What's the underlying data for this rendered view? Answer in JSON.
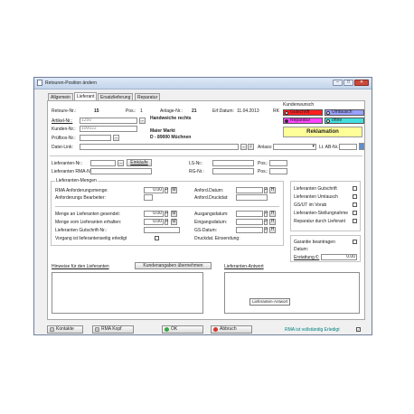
{
  "window": {
    "title": "Retouren-Position ändern",
    "icon": "document-icon"
  },
  "tabs": [
    {
      "label": "Allgemein",
      "active": false
    },
    {
      "label": "Lieferant",
      "active": true
    },
    {
      "label": "Ersatzlieferung",
      "active": false
    },
    {
      "label": "Reparatur",
      "active": false
    }
  ],
  "header": {
    "retoure_label": "Retoure-Nr.:",
    "retoure_value": "15",
    "pos_label": "Pos.:",
    "pos_value": "1",
    "anlage_label": "Anlage-Nr.:",
    "anlage_value": "21",
    "erf_label": "Erf.Datum:",
    "erf_value": "11.04.2013",
    "erf_user": "RK",
    "artikel_label": "Artikel-Nr.:",
    "artikel_value": "1250",
    "artikel_btn": "...",
    "artikel_name": "Handweiche rechts",
    "kunde_label": "Kunden-Nr.:",
    "kunde_value": "100022",
    "kunde_name": "Maier Markt",
    "kunde_city": "D - 89000 Müchnen",
    "pruef_label": "Prüfbox-Nr.:",
    "pruef_btn": "...",
    "datei_label": "Datei-Link:",
    "datei_btn": "...",
    "anlass_label": "Anlass:",
    "ltab_label": "Lt. AB-Nr.:"
  },
  "kundenwunsch": {
    "title": "Kundenwunsch",
    "options": [
      {
        "label": "Gutschrift",
        "color": "#ff1f1f"
      },
      {
        "label": "Umtausch",
        "color": "#9aa0ff"
      },
      {
        "label": "Reparatur",
        "color": "#ff44ff"
      },
      {
        "label": "ohne",
        "color": "#44dddd"
      }
    ],
    "status": "Reklamation",
    "status_color": "#ffff99"
  },
  "lieferant": {
    "nr_label": "Lieferanten-Nr.:",
    "einkaufe_btn": "Einkäufe",
    "ls_label": "LS-Nr.:",
    "pos1_label": "Pos.:",
    "rma_label": "Lieferanten RMA-Nr.:",
    "rg_label": "RG-Nr.:",
    "pos2_label": "Pos.:"
  },
  "mengen": {
    "title": "Lieferanten-Mengen",
    "rma_menge_label": "RMA Anforderungsmenge:",
    "rma_menge_value": "0.00",
    "m_btn": "M",
    "anford_bearb_label": "Anforderungs Bearbeiter:",
    "anford_datum_label": "Anford.Datum:",
    "h_btn": "H",
    "anford_druck_label": "Anford.Druckdat:",
    "menge_gesendet_label": "Menge an Lieferanten gesendet:",
    "menge_gesendet_value": "0.00",
    "menge_erhalten_label": "Menge vom Lieferanten erhalten:",
    "menge_erhalten_value": "0.00",
    "gutschrift_nr_label": "Lieferanten Gutschrift-Nr.:",
    "vorgang_label": "Vorgang ist lieferantenseitig erledigt",
    "ausgang_label": "Ausgangsdatum:",
    "eingang_label": "Eingangsdatum:",
    "gs_label": "GS-Datum:",
    "druck_einsendung_label": "Druckdat. Einsendung:"
  },
  "checks": [
    "Lieferanten Gutschrift",
    "Lieferanten Umtausch",
    "GS/UT im Vorab",
    "Lieferanten-Stellungnahme",
    "Reparatur durch Lieferant"
  ],
  "garantie": {
    "label": "Garantie beantragen",
    "datum_label": "Datum:",
    "erstattung_label": "Erstattung €:",
    "erstattung_value": "0.00"
  },
  "hinweise": {
    "label": "Hinweise für den Lieferanten",
    "btn": "Kundenangaben übernehmen"
  },
  "antwort": {
    "label": "Lieferanten-Antwort",
    "tooltip": "Lieferanten-Antwort"
  },
  "footer": {
    "kontakte": "Kontakte",
    "rma_kopf": "RMA Kopf",
    "ok": "OK",
    "abbruch": "Abbruch",
    "erledigt": "RMA ist vollständig Erledigt",
    "erledigt_color": "#008080"
  }
}
